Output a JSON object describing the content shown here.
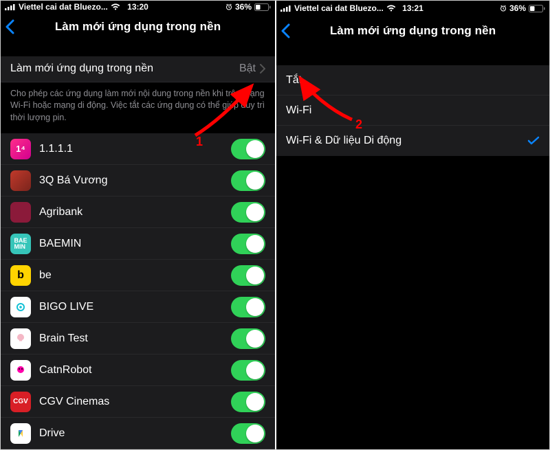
{
  "left": {
    "status": {
      "carrier": "Viettel cai dat Bluezo...",
      "time": "13:20",
      "battery": "36%"
    },
    "title": "Làm mới ứng dụng trong nền",
    "main_row": {
      "label": "Làm mới ứng dụng trong nền",
      "value": "Bật"
    },
    "footer": "Cho phép các ứng dụng làm mới nội dung trong nền khi trên mạng Wi-Fi hoặc mạng di động. Việc tắt các ứng dụng có thể giúp duy trì thời lượng pin.",
    "apps": [
      {
        "name": "1.1.1.1"
      },
      {
        "name": "3Q Bá Vương"
      },
      {
        "name": "Agribank"
      },
      {
        "name": "BAEMIN"
      },
      {
        "name": "be"
      },
      {
        "name": "BIGO LIVE"
      },
      {
        "name": "Brain Test"
      },
      {
        "name": "CatnRobot"
      },
      {
        "name": "CGV Cinemas"
      },
      {
        "name": "Drive"
      }
    ],
    "annotation": "1"
  },
  "right": {
    "status": {
      "carrier": "Viettel cai dat Bluezo...",
      "time": "13:21",
      "battery": "36%"
    },
    "title": "Làm mới ứng dụng trong nền",
    "options": [
      {
        "label": "Tắt",
        "checked": false
      },
      {
        "label": "Wi-Fi",
        "checked": false
      },
      {
        "label": "Wi-Fi & Dữ liệu Di động",
        "checked": true
      }
    ],
    "annotation": "2"
  }
}
